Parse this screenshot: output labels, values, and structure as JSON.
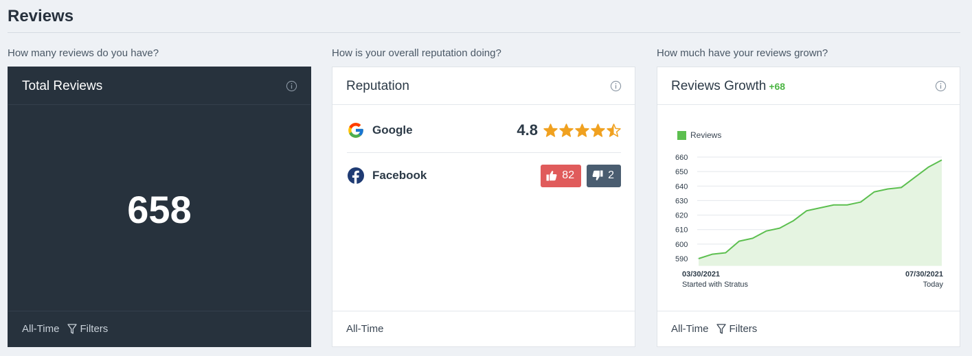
{
  "page": {
    "title": "Reviews"
  },
  "questions": {
    "total": "How many reviews do you have?",
    "reputation": "How is your overall reputation doing?",
    "growth": "How much have your reviews grown?"
  },
  "total_card": {
    "title": "Total Reviews",
    "value": "658",
    "footer_period": "All-Time",
    "filters_label": "Filters"
  },
  "reputation_card": {
    "title": "Reputation",
    "google": {
      "name": "Google",
      "rating": "4.8",
      "stars": 4.5
    },
    "facebook": {
      "name": "Facebook",
      "likes": "82",
      "dislikes": "2"
    },
    "footer_period": "All-Time"
  },
  "growth_card": {
    "title": "Reviews Growth",
    "delta": "+68",
    "footer_period": "All-Time",
    "filters_label": "Filters",
    "start_date": "03/30/2021",
    "start_caption": "Started with Stratus",
    "end_date": "07/30/2021",
    "end_caption": "Today"
  },
  "colors": {
    "accent_green": "#4bb543",
    "like_red": "#e05b5b",
    "dislike_slate": "#4a5d70",
    "star_orange": "#f0a120",
    "dark_card": "#27323d"
  },
  "icons": {
    "info": "info-icon",
    "filter": "filter-funnel-icon",
    "google": "google-logo-icon",
    "facebook": "facebook-logo-icon",
    "thumbs_up": "thumbs-up-icon",
    "thumbs_down": "thumbs-down-icon",
    "star": "star-icon"
  },
  "chart_data": {
    "type": "area",
    "series": [
      {
        "name": "Reviews",
        "values": [
          590,
          593,
          594,
          602,
          604,
          609,
          611,
          616,
          623,
          625,
          627,
          627,
          629,
          636,
          638,
          639,
          646,
          653,
          658
        ]
      }
    ],
    "x_start_label": "03/30/2021",
    "x_end_label": "07/30/2021",
    "ylim": [
      585,
      660
    ],
    "y_ticks": [
      590,
      600,
      610,
      620,
      630,
      640,
      650,
      660
    ],
    "grid": true,
    "legend": "top-left"
  }
}
